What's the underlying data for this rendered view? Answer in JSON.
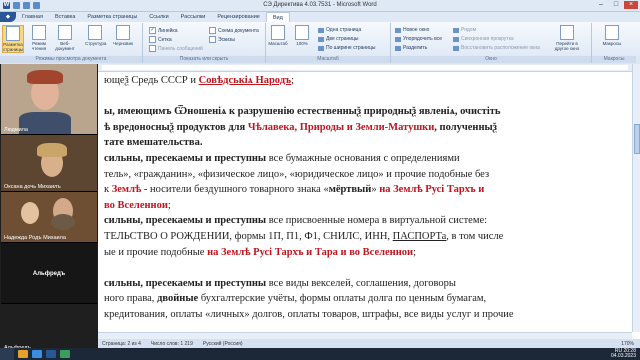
{
  "window": {
    "title": "СЭ Директива 4.03.7531 - Microsoft Word"
  },
  "tabs": [
    "Главная",
    "Вставка",
    "Разметка страницы",
    "Ссылки",
    "Рассылки",
    "Рецензирование",
    "Вид"
  ],
  "ribbon": {
    "view_modes": {
      "buttons": [
        "Разметка страницы",
        "Режим чтения",
        "Веб-документ",
        "Структура",
        "Черновик"
      ],
      "group_label": "Режимы просмотра документа"
    },
    "show_hide": {
      "items": [
        {
          "label": "Линейка",
          "checked": true
        },
        {
          "label": "Сетка",
          "checked": false
        },
        {
          "label": "Панель сообщений",
          "checked": false
        },
        {
          "label": "Схема документа",
          "checked": false
        },
        {
          "label": "Эскизы",
          "checked": false
        }
      ],
      "group_label": "Показать или скрыть"
    },
    "zoom": {
      "buttons": [
        "Масштаб",
        "100%"
      ],
      "small": [
        "Одна страница",
        "Две страницы",
        "По ширине страницы"
      ],
      "group_label": "Масштаб"
    },
    "window": {
      "small": [
        "Новое окно",
        "Упорядочить все",
        "Разделить"
      ],
      "small_right": [
        "Рядом",
        "Синхронная прокрутка",
        "Восстановить расположение окна"
      ],
      "big": "Перейти в другое окно",
      "group_label": "Окно"
    },
    "macros": {
      "label": "Макросы",
      "group_label": "Макросы"
    }
  },
  "participants": [
    {
      "name": "Людмила"
    },
    {
      "name": "Оксана дочь Михаилъ"
    },
    {
      "name": "Надежда Родъ Михаила"
    },
    {
      "name": "Альфредъ"
    },
    {
      "name": "Альфредъ"
    }
  ],
  "document": {
    "lines": [
      {
        "parts": [
          {
            "t": "ющеѯ Средь СССР и "
          },
          {
            "t": "Совѣдськіѧ Народъ",
            "s": "r u"
          },
          {
            "t": ";"
          }
        ]
      },
      {
        "parts": [
          {
            "t": "",
            "s": ""
          }
        ]
      },
      {
        "parts": [
          {
            "t": "ы, имеющимъ Ѿношеніѧ к разрушенію естественныѯ природныѯ явленіѧ, очистіть",
            "s": "b"
          }
        ]
      },
      {
        "parts": [
          {
            "t": "ѣ вредоносныѯ продуктов для ",
            "s": "b"
          },
          {
            "t": "Чѣлавека, Природы и Земли-Матушки",
            "s": "r"
          },
          {
            "t": ", полученныѯ",
            "s": "b"
          }
        ]
      },
      {
        "parts": [
          {
            "t": "тате вмешательства.",
            "s": "b"
          }
        ]
      },
      {
        "parts": [
          {
            "t": "сильны, пресекаемы и преступны",
            "s": "b"
          },
          {
            "t": " все бумажные основания с определениями"
          }
        ]
      },
      {
        "parts": [
          {
            "t": "тель», «гражданин», «физическое лицо», «юридическое лицо» и прочие подобные без"
          }
        ]
      },
      {
        "parts": [
          {
            "t": "к "
          },
          {
            "t": "Землѣ",
            "s": "r"
          },
          {
            "t": " - носители бездушного товарного знака «"
          },
          {
            "t": "мёртвый",
            "s": "b"
          },
          {
            "t": "» "
          },
          {
            "t": "на Землѣ Русі Тархъ и",
            "s": "r"
          }
        ]
      },
      {
        "parts": [
          {
            "t": "во Вселеннои",
            "s": "r"
          },
          {
            "t": ";"
          }
        ]
      },
      {
        "parts": [
          {
            "t": "сильны, пресекаемы и преступны",
            "s": "b"
          },
          {
            "t": " все присвоенные номера в виртуальной системе:"
          }
        ]
      },
      {
        "parts": [
          {
            "t": "ТЕЛЬСТВО О РОЖДЕНИИ, формы 1П, П1, Ф1, СНИЛС, ИНН, "
          },
          {
            "t": "ПАСПОРТа",
            "s": "u"
          },
          {
            "t": ", в том числе"
          }
        ]
      },
      {
        "parts": [
          {
            "t": "ые и прочие подобные "
          },
          {
            "t": "на Землѣ Русі Тархъ и Тара и во Вселеннои",
            "s": "r"
          },
          {
            "t": ";"
          }
        ]
      },
      {
        "parts": [
          {
            "t": "",
            "s": ""
          }
        ]
      },
      {
        "parts": [
          {
            "t": "сильны, пресекаемы и преступны",
            "s": "b"
          },
          {
            "t": " все виды векселей, соглашения, договоры"
          }
        ]
      },
      {
        "parts": [
          {
            "t": "ного права, "
          },
          {
            "t": "двойные",
            "s": "b"
          },
          {
            "t": " бухгалтерские учёты, формы оплаты долга по ценным бумагам,"
          }
        ]
      },
      {
        "parts": [
          {
            "t": "кредитования, оплаты «личных» долгов, оплаты товаров, штрафы, все виды услуг и прочие"
          }
        ]
      }
    ]
  },
  "statusbar": {
    "page": "Страница: 2 из 4",
    "words": "Число слов: 1 219",
    "lang": "Русский (Россия)",
    "zoom": "170%"
  },
  "taskbar": {
    "lang": "RU",
    "time": "20:28",
    "date": "04.03.2023"
  },
  "colors": {
    "accent_red": "#c0161e",
    "ribbon": "#dbe6f4",
    "word_blue": "#2b5797"
  },
  "icons": [
    "word-icon",
    "save-icon",
    "undo-icon",
    "redo-icon",
    "minimize-icon",
    "maximize-icon",
    "close-icon"
  ]
}
